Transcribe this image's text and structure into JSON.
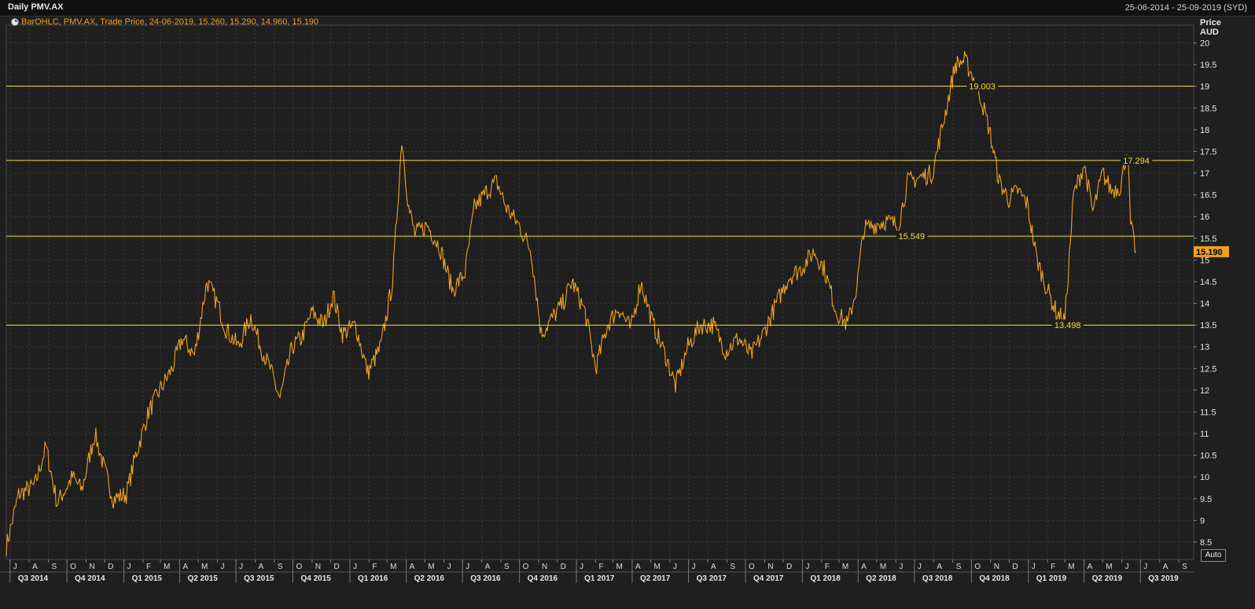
{
  "header": {
    "title": "Daily PMV.AX",
    "date_range": "25-06-2014 - 25-09-2019 (SYD)",
    "legend": "BarOHLC, PMV.AX, Trade Price, 24-06-2019, 15.260, 15.290, 14.960, 15.190",
    "auto_label": "Auto"
  },
  "colors": {
    "background": "#1f1f1f",
    "price": "#f0a020",
    "levels": "#f0e030",
    "grid": "#3a3a3a",
    "last_price_badge": "#f0a020"
  },
  "chart_data": {
    "type": "line",
    "title": "Daily PMV.AX",
    "ylabel": "Price\nAUD",
    "ylabel_lines": [
      "Price",
      "AUD"
    ],
    "ylim": [
      8.1,
      20.3
    ],
    "y_ticks": [
      8.5,
      9,
      9.5,
      10,
      10.5,
      11,
      11.5,
      12,
      12.5,
      13,
      13.5,
      14,
      14.5,
      15,
      15.5,
      16,
      16.5,
      17,
      17.5,
      18,
      18.5,
      19,
      19.5,
      20
    ],
    "y_tick_labels": [
      "8.5",
      "9",
      "9.5",
      "10",
      "10.5",
      "11",
      "11.5",
      "12",
      "12.5",
      "13",
      "13.5",
      "14",
      "14.5",
      "15",
      "15.5",
      "16",
      "16.5",
      "17",
      "17.5",
      "18",
      "18.5",
      "19",
      "19.5",
      "20"
    ],
    "month_labels": [
      "J",
      "A",
      "S",
      "O",
      "N",
      "D",
      "J",
      "F",
      "M",
      "A",
      "M",
      "J",
      "J",
      "A",
      "S",
      "O",
      "N",
      "D",
      "J",
      "F",
      "M",
      "A",
      "M",
      "J",
      "J",
      "A",
      "S",
      "O",
      "N",
      "D",
      "J",
      "F",
      "M",
      "A",
      "M",
      "J",
      "J",
      "A",
      "S",
      "O",
      "N",
      "D",
      "J",
      "F",
      "M",
      "A",
      "M",
      "J",
      "J",
      "A",
      "S",
      "O",
      "N",
      "D",
      "J",
      "F",
      "M",
      "A",
      "M",
      "J",
      "J",
      "A",
      "S"
    ],
    "quarter_labels": [
      "Q3 2014",
      "Q4 2014",
      "Q1 2015",
      "Q2 2015",
      "Q3 2015",
      "Q4 2015",
      "Q1 2016",
      "Q2 2016",
      "Q3 2016",
      "Q4 2016",
      "Q1 2017",
      "Q2 2017",
      "Q3 2017",
      "Q4 2017",
      "Q1 2018",
      "Q2 2018",
      "Q3 2018",
      "Q4 2018",
      "Q1 2019",
      "Q2 2019",
      "Q3 2019"
    ],
    "series": [
      {
        "type": "line",
        "x": [
          "2014-06-25",
          "2014-07-15",
          "2014-08-10",
          "2014-08-28",
          "2014-09-15",
          "2014-10-10",
          "2014-10-25",
          "2014-11-15",
          "2014-11-30",
          "2014-12-15",
          "2015-01-05",
          "2015-01-20",
          "2015-02-10",
          "2015-02-28",
          "2015-03-20",
          "2015-04-05",
          "2015-04-25",
          "2015-05-15",
          "2015-06-01",
          "2015-06-15",
          "2015-07-05",
          "2015-07-25",
          "2015-08-10",
          "2015-08-25",
          "2015-09-10",
          "2015-09-30",
          "2015-10-15",
          "2015-11-01",
          "2015-11-20",
          "2015-12-05",
          "2015-12-20",
          "2016-01-10",
          "2016-01-30",
          "2016-02-20",
          "2016-03-10",
          "2016-03-25",
          "2016-04-05",
          "2016-04-15",
          "2016-05-05",
          "2016-05-25",
          "2016-06-15",
          "2016-07-05",
          "2016-07-20",
          "2016-08-10",
          "2016-08-25",
          "2016-09-10",
          "2016-09-30",
          "2016-10-20",
          "2016-11-05",
          "2016-11-20",
          "2016-12-10",
          "2016-12-25",
          "2017-01-15",
          "2017-02-01",
          "2017-02-20",
          "2017-03-10",
          "2017-03-30",
          "2017-04-15",
          "2017-05-05",
          "2017-05-25",
          "2017-06-10",
          "2017-06-30",
          "2017-07-20",
          "2017-08-10",
          "2017-08-30",
          "2017-09-20",
          "2017-10-10",
          "2017-10-30",
          "2017-11-20",
          "2017-12-10",
          "2017-12-30",
          "2018-01-20",
          "2018-02-05",
          "2018-02-25",
          "2018-03-15",
          "2018-03-30",
          "2018-04-10",
          "2018-04-25",
          "2018-05-15",
          "2018-06-05",
          "2018-06-20",
          "2018-07-10",
          "2018-07-30",
          "2018-08-20",
          "2018-09-05",
          "2018-09-20",
          "2018-10-01",
          "2018-10-15",
          "2018-10-30",
          "2018-11-15",
          "2018-11-30",
          "2018-12-15",
          "2018-12-30",
          "2019-01-15",
          "2019-02-01",
          "2019-02-15",
          "2019-03-01",
          "2019-03-15",
          "2019-04-01",
          "2019-04-15",
          "2019-05-01",
          "2019-05-15",
          "2019-05-30",
          "2019-06-10",
          "2019-06-15",
          "2019-06-24"
        ],
        "y": [
          8.4,
          9.6,
          9.8,
          10.7,
          9.4,
          10.0,
          9.7,
          11.0,
          10.2,
          9.5,
          9.6,
          10.5,
          11.5,
          12.0,
          12.5,
          13.2,
          12.8,
          14.5,
          14.0,
          13.4,
          13.0,
          13.7,
          13.0,
          12.5,
          11.8,
          13.0,
          13.2,
          13.8,
          13.5,
          14.2,
          13.3,
          13.5,
          12.4,
          13.0,
          14.5,
          17.8,
          16.2,
          15.6,
          15.8,
          15.3,
          14.3,
          14.7,
          16.2,
          16.6,
          16.8,
          16.2,
          15.8,
          15.2,
          13.3,
          13.6,
          14.0,
          14.5,
          13.8,
          12.5,
          13.5,
          13.9,
          13.4,
          14.5,
          13.5,
          12.8,
          12.1,
          13.0,
          13.5,
          13.5,
          12.9,
          13.2,
          12.8,
          13.3,
          14.0,
          14.6,
          14.8,
          15.2,
          14.8,
          13.8,
          13.5,
          14.4,
          15.7,
          15.8,
          15.9,
          15.8,
          16.8,
          16.9,
          17.0,
          18.4,
          19.5,
          19.6,
          19.3,
          18.8,
          18.0,
          16.8,
          16.4,
          16.6,
          16.3,
          15.0,
          14.3,
          13.8,
          13.6,
          16.5,
          17.2,
          16.1,
          17.0,
          16.6,
          16.7,
          17.6,
          15.8,
          15.19
        ]
      }
    ],
    "reference_lines": [
      {
        "value": 19.003,
        "label": "19.003"
      },
      {
        "value": 17.294,
        "label": "17.294"
      },
      {
        "value": 15.549,
        "label": "15.549"
      },
      {
        "value": 13.498,
        "label": "13.498"
      }
    ],
    "last_price": {
      "value": 15.19,
      "label": "15.190"
    },
    "grid": true
  }
}
